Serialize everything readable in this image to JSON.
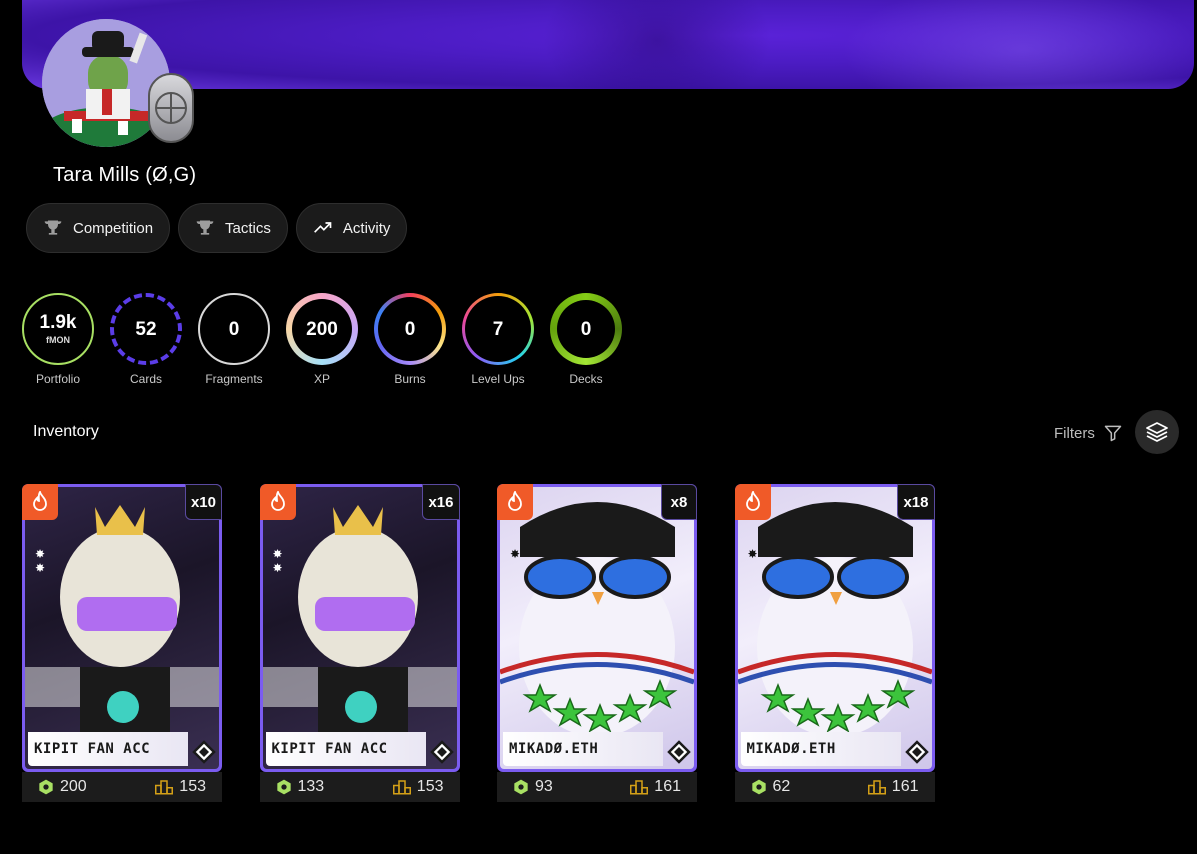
{
  "profile": {
    "username": "Tara Mills (Ø,G)"
  },
  "tabs": [
    {
      "label": "Competition",
      "icon": "trophy-icon"
    },
    {
      "label": "Tactics",
      "icon": "trophy-icon"
    },
    {
      "label": "Activity",
      "icon": "trending-up-icon"
    }
  ],
  "stats": [
    {
      "value": "1.9k",
      "unit": "fMON",
      "label": "Portfolio"
    },
    {
      "value": "52",
      "label": "Cards"
    },
    {
      "value": "0",
      "label": "Fragments"
    },
    {
      "value": "200",
      "label": "XP"
    },
    {
      "value": "0",
      "label": "Burns"
    },
    {
      "value": "7",
      "label": "Level Ups"
    },
    {
      "value": "0",
      "label": "Decks"
    }
  ],
  "inventory": {
    "title": "Inventory",
    "filters_label": "Filters",
    "cards": [
      {
        "name": "KIPIT FAN ACC",
        "qty": "x10",
        "value": "200",
        "rank": "153"
      },
      {
        "name": "KIPIT FAN ACC",
        "qty": "x16",
        "value": "133",
        "rank": "153"
      },
      {
        "name": "MIKADØ.ETH",
        "qty": "x8",
        "value": "93",
        "rank": "161"
      },
      {
        "name": "MIKADØ.ETH",
        "qty": "x18",
        "value": "62",
        "rank": "161"
      }
    ]
  },
  "colors": {
    "accent_purple": "#7b5cf0",
    "fire_orange": "#f05a28",
    "gem_green": "#a8e063",
    "rank_gold": "#d4a017"
  }
}
